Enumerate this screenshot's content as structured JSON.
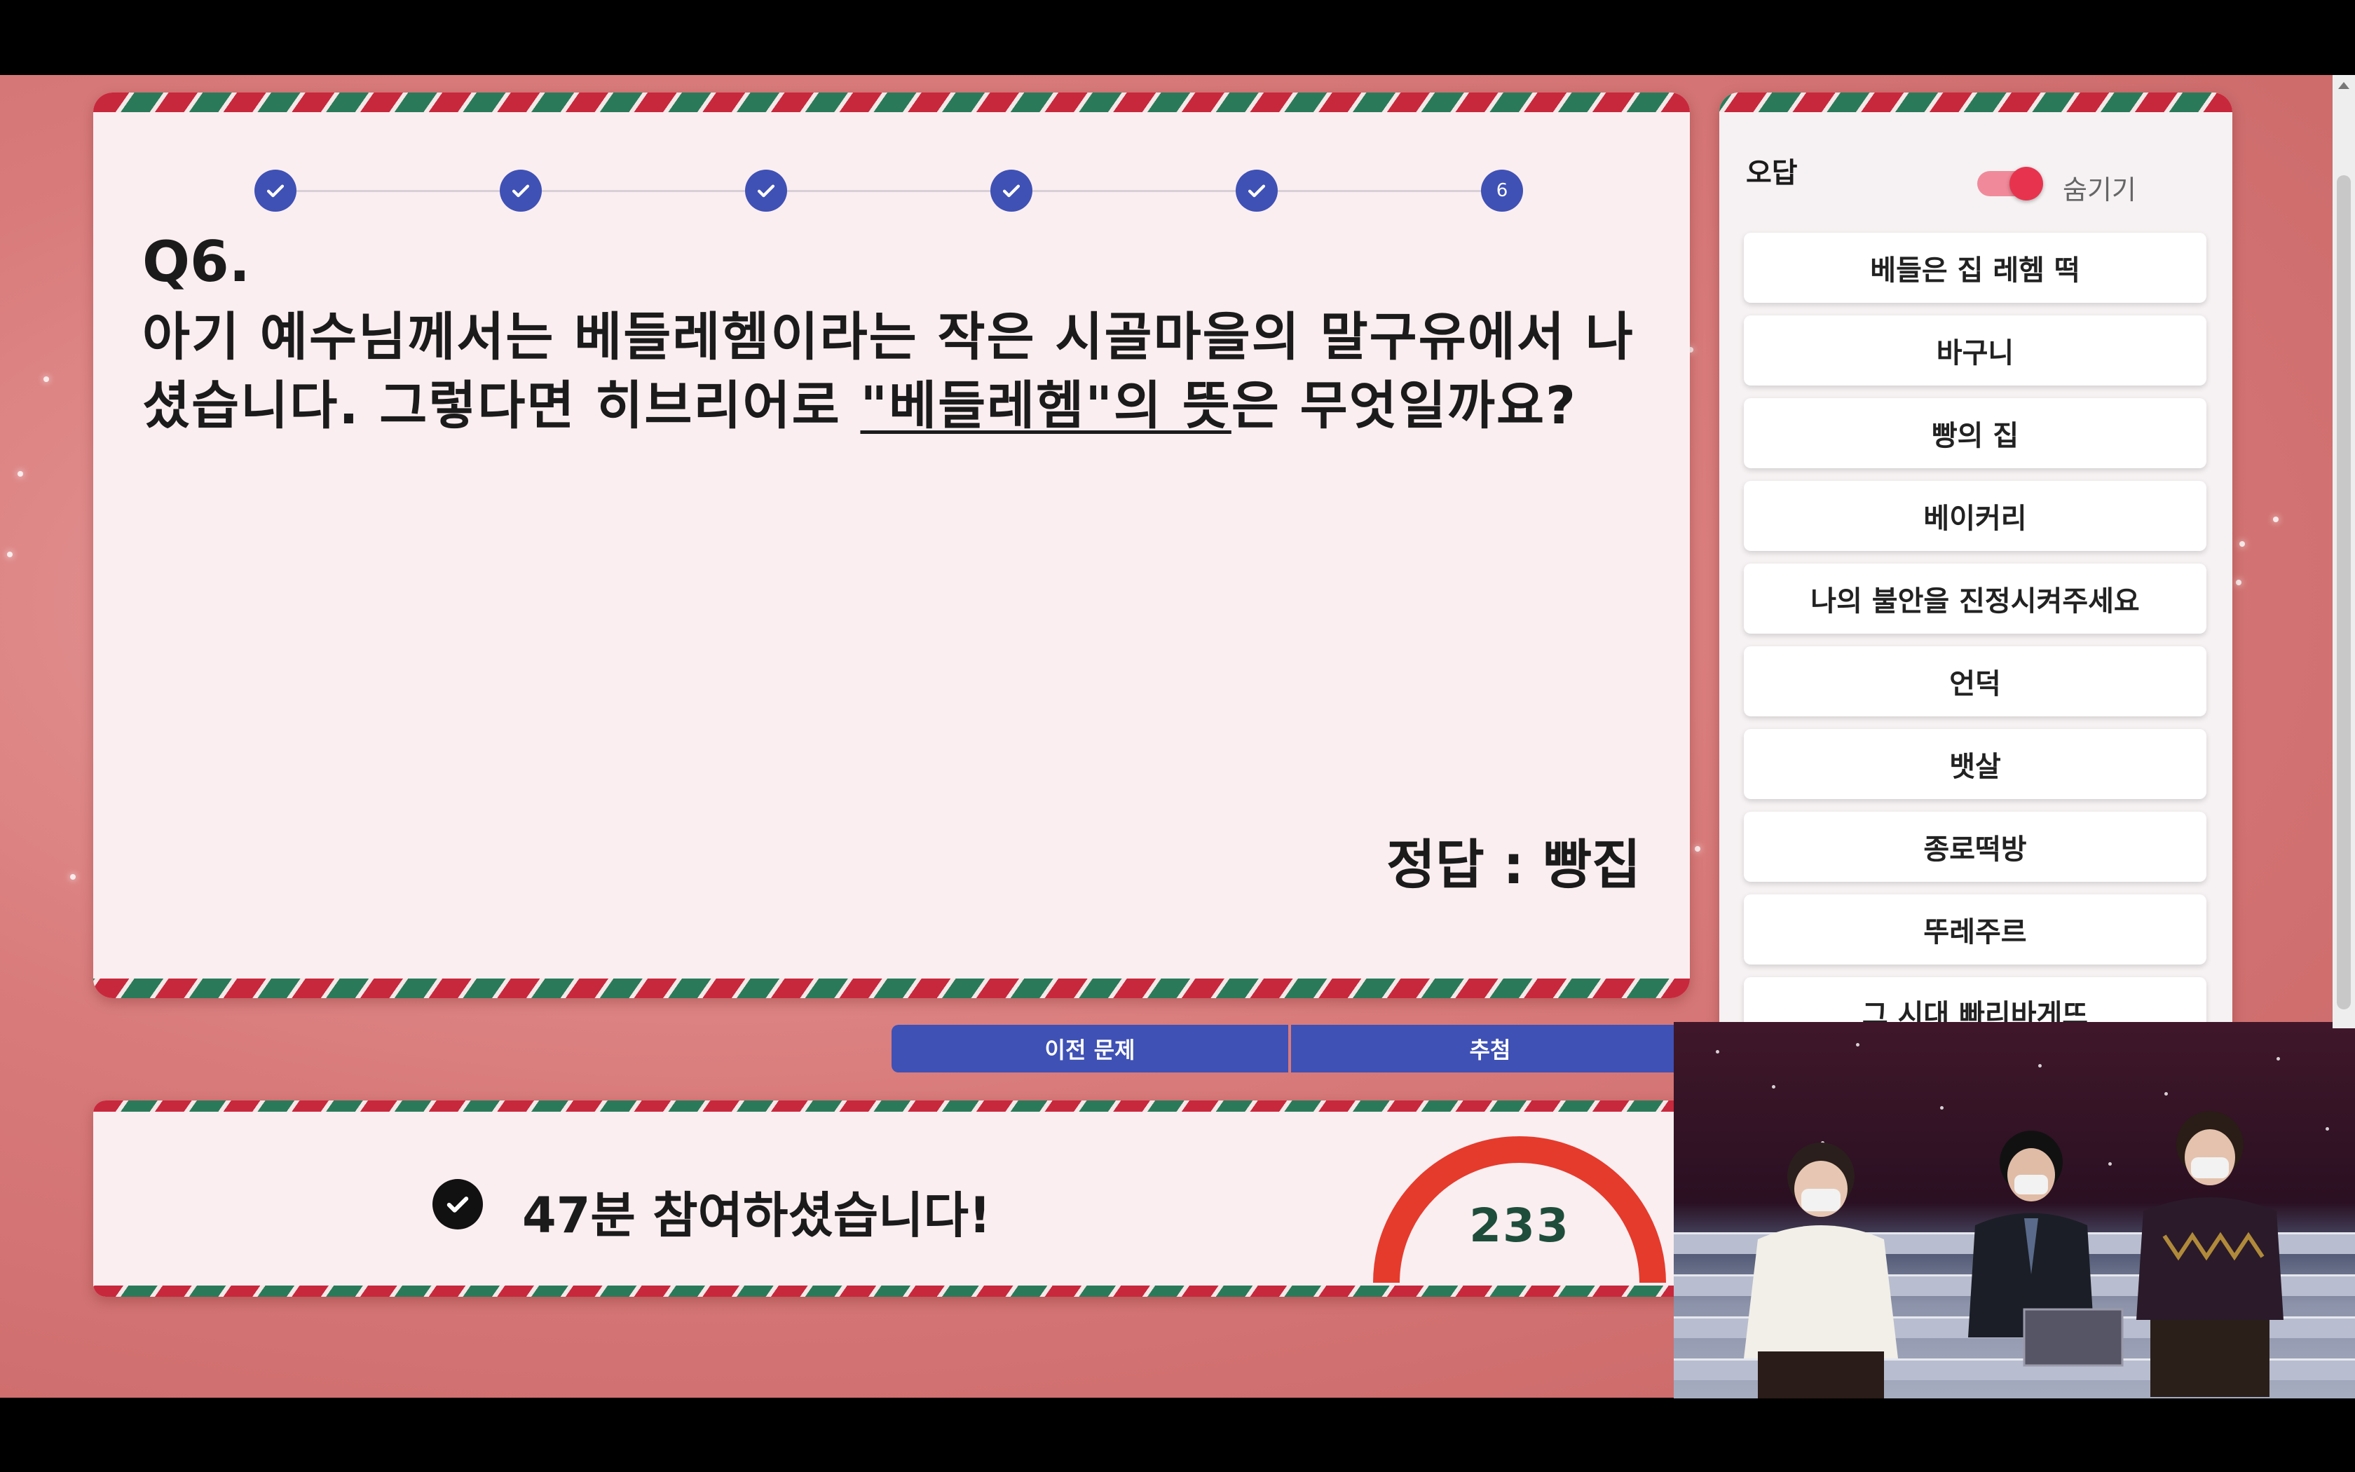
{
  "progress": {
    "steps": [
      {
        "state": "done",
        "label": ""
      },
      {
        "state": "done",
        "label": ""
      },
      {
        "state": "done",
        "label": ""
      },
      {
        "state": "done",
        "label": ""
      },
      {
        "state": "done",
        "label": ""
      },
      {
        "state": "current",
        "label": "6"
      }
    ]
  },
  "question": {
    "label": "Q6.",
    "text_before": "아기 예수님께서는 베들레헴이라는 작은 시골마을의 말구유에서 나셨습니다. 그렇다면 히브리어로 ",
    "highlight": "\"베들레헴\"의 뜻",
    "text_after": "은 무엇일까요?",
    "answer": "정답 : 빵집"
  },
  "wrong_answers": {
    "title": "오답",
    "toggle_label": "숨기기",
    "toggle_on": true,
    "items": [
      "베들은 집 레헴 떡",
      "바구니",
      "빵의 집",
      "베이커리",
      "나의 불안을 진정시켜주세요",
      "언덕",
      "뱃살",
      "종로떡방",
      "뚜레주르",
      "그 시대 빠리바게뜨"
    ]
  },
  "buttons": {
    "prev": "이전 문제",
    "draw": "추첨"
  },
  "participants": {
    "text": "47분 참여하셨습니다!",
    "count": "233"
  },
  "colors": {
    "primary": "#3f51b5",
    "candy_red": "#c8283c",
    "candy_green": "#2a7a5a",
    "gauge_red": "#e53b2c",
    "count_green": "#1e4d3b"
  }
}
